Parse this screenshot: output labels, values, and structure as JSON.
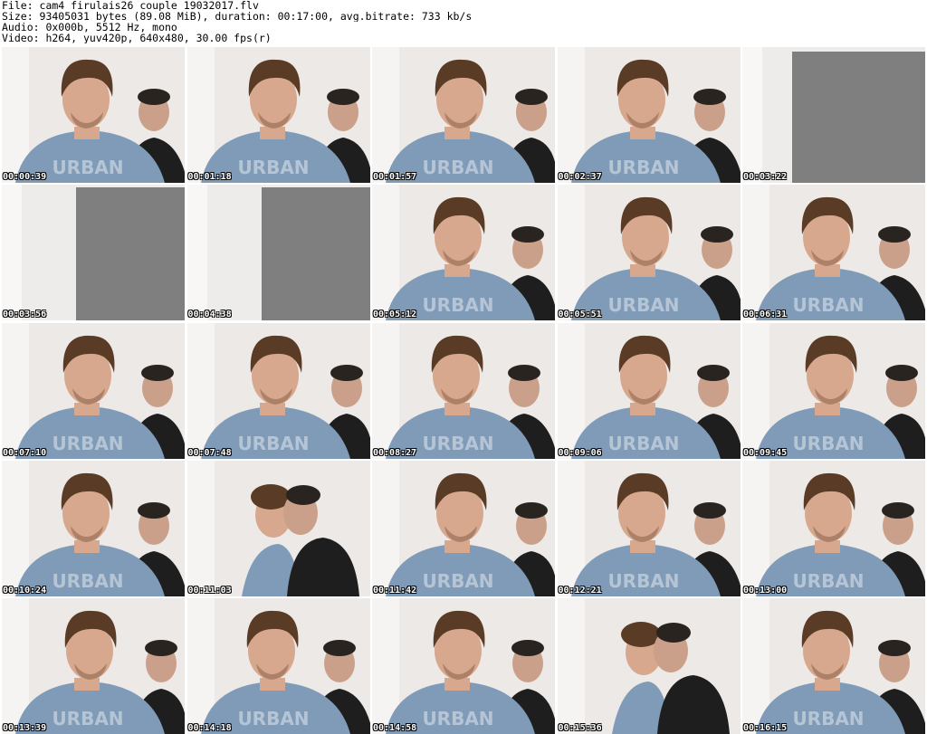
{
  "header": {
    "file_line": "File: cam4_firulais26_couple_19032017.flv",
    "size_line": "Size: 93405031 bytes (89.08 MiB), duration: 00:17:00, avg.bitrate: 733 kb/s",
    "audio_line": "Audio: 0x000b, 5512 Hz, mono",
    "video_line": "Video: h264, yuv420p, 640x480, 30.00 fps(r)"
  },
  "shirt_text": "URBAN",
  "thumbnails": [
    {
      "time": "00:00:39",
      "scene": "pair"
    },
    {
      "time": "00:01:18",
      "scene": "pair"
    },
    {
      "time": "00:01:57",
      "scene": "pair"
    },
    {
      "time": "00:02:37",
      "scene": "pair"
    },
    {
      "time": "00:03:22",
      "scene": "empty"
    },
    {
      "time": "00:03:56",
      "scene": "empty"
    },
    {
      "time": "00:04:38",
      "scene": "empty"
    },
    {
      "time": "00:05:12",
      "scene": "pair"
    },
    {
      "time": "00:05:51",
      "scene": "pair"
    },
    {
      "time": "00:06:31",
      "scene": "pair"
    },
    {
      "time": "00:07:10",
      "scene": "pair"
    },
    {
      "time": "00:07:48",
      "scene": "pair"
    },
    {
      "time": "00:08:27",
      "scene": "pair"
    },
    {
      "time": "00:09:06",
      "scene": "pair"
    },
    {
      "time": "00:09:45",
      "scene": "pair"
    },
    {
      "time": "00:10:24",
      "scene": "pair"
    },
    {
      "time": "00:11:03",
      "scene": "kiss"
    },
    {
      "time": "00:11:42",
      "scene": "pair"
    },
    {
      "time": "00:12:21",
      "scene": "pair"
    },
    {
      "time": "00:13:00",
      "scene": "pair"
    },
    {
      "time": "00:13:39",
      "scene": "pair"
    },
    {
      "time": "00:14:18",
      "scene": "pair"
    },
    {
      "time": "00:14:58",
      "scene": "pair"
    },
    {
      "time": "00:15:36",
      "scene": "kiss"
    },
    {
      "time": "00:16:15",
      "scene": "pair"
    }
  ],
  "colors": {
    "wall": "#ece9e6",
    "panel": "#7f7f7f",
    "shirt": "#7f9bb8",
    "skin": "#d7a88e",
    "hair": "#5a3b26",
    "black_shirt": "#1e1e1e",
    "dark_hair": "#2a2420"
  }
}
